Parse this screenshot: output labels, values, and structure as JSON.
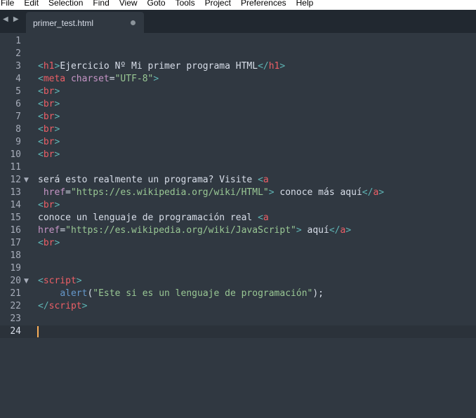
{
  "menu": [
    "File",
    "Edit",
    "Selection",
    "Find",
    "View",
    "Goto",
    "Tools",
    "Project",
    "Preferences",
    "Help"
  ],
  "tab": {
    "title": "primer_test.html"
  },
  "nav": {
    "arrows": "◀ ▶"
  },
  "editor": {
    "active_line": 24,
    "lines": [
      {
        "n": "1",
        "fold": false,
        "tokens": []
      },
      {
        "n": "2",
        "fold": false,
        "tokens": []
      },
      {
        "n": "3",
        "fold": false,
        "tokens": [
          [
            "t",
            "<"
          ],
          [
            "n",
            "h1"
          ],
          [
            "t",
            ">"
          ],
          [
            "p",
            "Ejercicio Nº Mi primer programa HTML"
          ],
          [
            "t",
            "</"
          ],
          [
            "n",
            "h1"
          ],
          [
            "t",
            ">"
          ]
        ]
      },
      {
        "n": "4",
        "fold": false,
        "tokens": [
          [
            "t",
            "<"
          ],
          [
            "n",
            "meta"
          ],
          [
            "p",
            " "
          ],
          [
            "a",
            "charset"
          ],
          [
            "p",
            "="
          ],
          [
            "s",
            "\"UTF-8\""
          ],
          [
            "t",
            ">"
          ]
        ]
      },
      {
        "n": "5",
        "fold": false,
        "tokens": [
          [
            "t",
            "<"
          ],
          [
            "n",
            "br"
          ],
          [
            "t",
            ">"
          ]
        ]
      },
      {
        "n": "6",
        "fold": false,
        "tokens": [
          [
            "t",
            "<"
          ],
          [
            "n",
            "br"
          ],
          [
            "t",
            ">"
          ]
        ]
      },
      {
        "n": "7",
        "fold": false,
        "tokens": [
          [
            "t",
            "<"
          ],
          [
            "n",
            "br"
          ],
          [
            "t",
            ">"
          ]
        ]
      },
      {
        "n": "8",
        "fold": false,
        "tokens": [
          [
            "t",
            "<"
          ],
          [
            "n",
            "br"
          ],
          [
            "t",
            ">"
          ]
        ]
      },
      {
        "n": "9",
        "fold": false,
        "tokens": [
          [
            "t",
            "<"
          ],
          [
            "n",
            "br"
          ],
          [
            "t",
            ">"
          ]
        ]
      },
      {
        "n": "10",
        "fold": false,
        "tokens": [
          [
            "t",
            "<"
          ],
          [
            "n",
            "br"
          ],
          [
            "t",
            ">"
          ]
        ]
      },
      {
        "n": "11",
        "fold": false,
        "tokens": []
      },
      {
        "n": "12",
        "fold": true,
        "tokens": [
          [
            "p",
            "será esto realmente un programa? Visite "
          ],
          [
            "t",
            "<"
          ],
          [
            "n",
            "a"
          ]
        ]
      },
      {
        "n": "13",
        "fold": false,
        "tokens": [
          [
            "p",
            " "
          ],
          [
            "a",
            "href"
          ],
          [
            "p",
            "="
          ],
          [
            "s",
            "\"https://es.wikipedia.org/wiki/HTML\""
          ],
          [
            "t",
            ">"
          ],
          [
            "p",
            " conoce más aquí"
          ],
          [
            "t",
            "</"
          ],
          [
            "n",
            "a"
          ],
          [
            "t",
            ">"
          ]
        ]
      },
      {
        "n": "14",
        "fold": false,
        "tokens": [
          [
            "t",
            "<"
          ],
          [
            "n",
            "br"
          ],
          [
            "t",
            ">"
          ]
        ]
      },
      {
        "n": "15",
        "fold": false,
        "tokens": [
          [
            "p",
            "conoce un lenguaje de programación real "
          ],
          [
            "t",
            "<"
          ],
          [
            "n",
            "a"
          ]
        ]
      },
      {
        "n": "16",
        "fold": false,
        "tokens": [
          [
            "a",
            "href"
          ],
          [
            "p",
            "="
          ],
          [
            "s",
            "\"https://es.wikipedia.org/wiki/JavaScript\""
          ],
          [
            "t",
            ">"
          ],
          [
            "p",
            " aquí"
          ],
          [
            "t",
            "</"
          ],
          [
            "n",
            "a"
          ],
          [
            "t",
            ">"
          ]
        ]
      },
      {
        "n": "17",
        "fold": false,
        "tokens": [
          [
            "t",
            "<"
          ],
          [
            "n",
            "br"
          ],
          [
            "t",
            ">"
          ]
        ]
      },
      {
        "n": "18",
        "fold": false,
        "tokens": []
      },
      {
        "n": "19",
        "fold": false,
        "tokens": []
      },
      {
        "n": "20",
        "fold": true,
        "tokens": [
          [
            "t",
            "<"
          ],
          [
            "n",
            "script"
          ],
          [
            "t",
            ">"
          ]
        ]
      },
      {
        "n": "21",
        "fold": false,
        "tokens": [
          [
            "p",
            "    "
          ],
          [
            "f",
            "alert"
          ],
          [
            "p",
            "("
          ],
          [
            "s",
            "\"Este si es un lenguaje de programación\""
          ],
          [
            "p",
            ");"
          ]
        ]
      },
      {
        "n": "22",
        "fold": false,
        "tokens": [
          [
            "t",
            "</"
          ],
          [
            "n",
            "script"
          ],
          [
            "t",
            ">"
          ]
        ]
      },
      {
        "n": "23",
        "fold": false,
        "tokens": []
      },
      {
        "n": "24",
        "fold": false,
        "tokens": []
      }
    ]
  }
}
